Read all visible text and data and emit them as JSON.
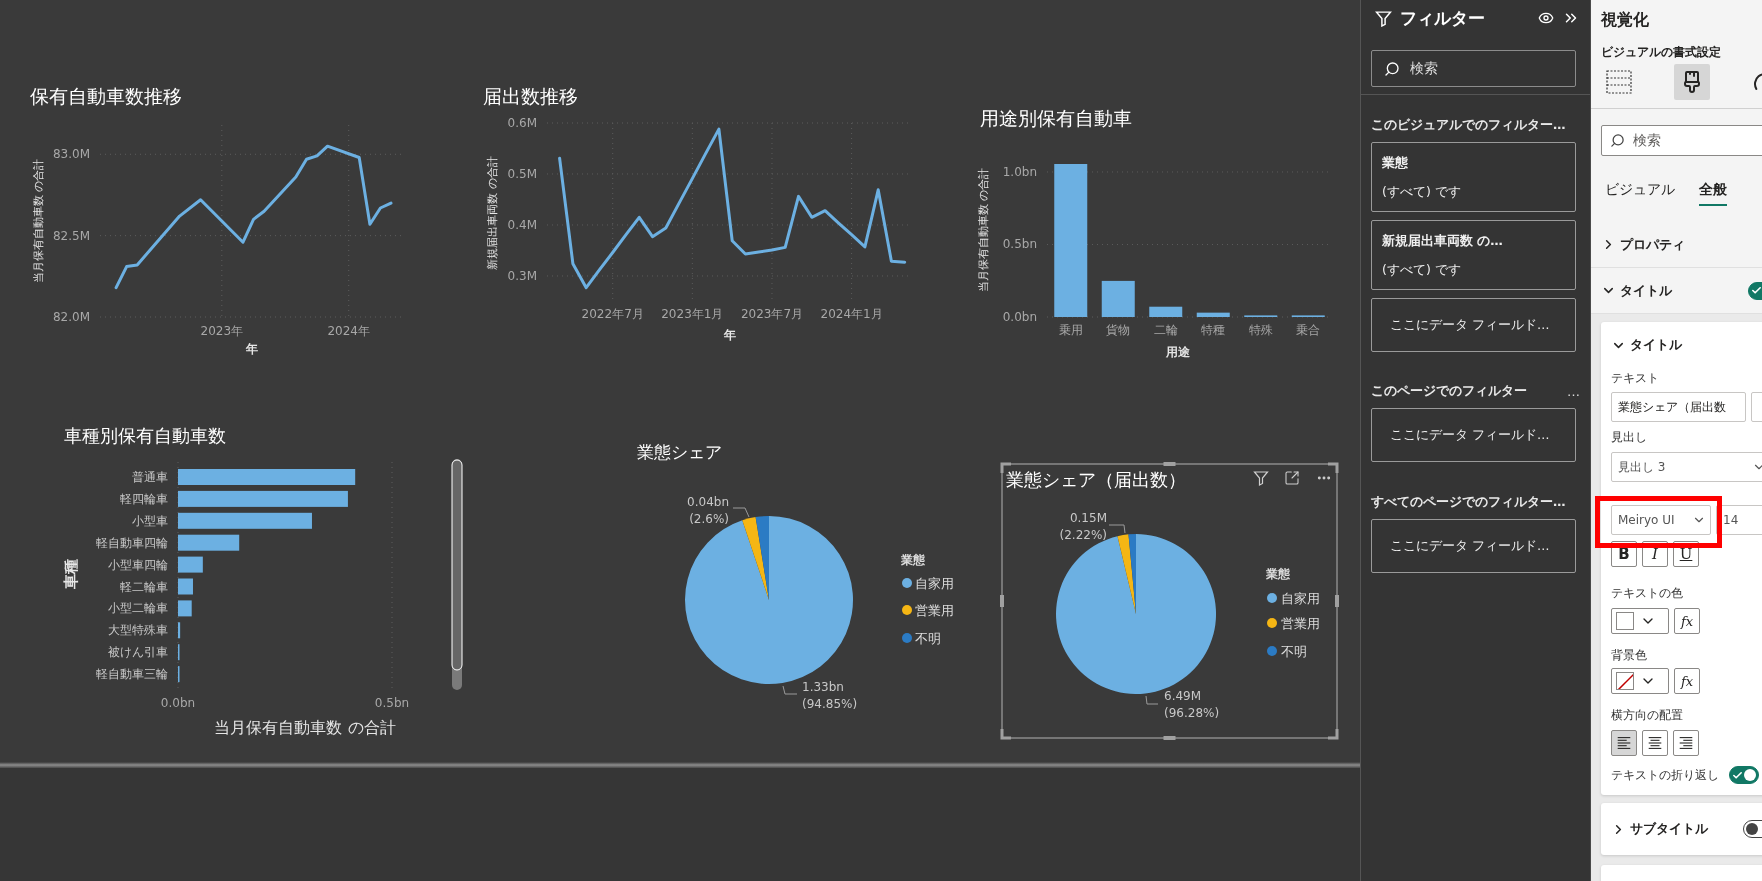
{
  "visuals": [
    {
      "selected": false,
      "title": "保有自動車数推移",
      "chart_data": {
        "type": "line",
        "grid": true,
        "xlabel": "年",
        "ylabel": "当月保有自動車数 の合計",
        "x": [
          2022.167,
          2022.25,
          2022.333,
          2022.667,
          2022.833,
          2023.167,
          2023.25,
          2023.333,
          2023.583,
          2023.667,
          2023.75,
          2023.833,
          2024.083,
          2024.167,
          2024.25,
          2024.333
        ],
        "series": [
          {
            "color": "#6cb0e2",
            "values": [
              82.18,
              82.31,
              82.32,
              82.62,
              82.72,
              82.46,
              82.6,
              82.65,
              82.86,
              82.97,
              82.99,
              83.05,
              82.98,
              82.57,
              82.67,
              82.7
            ]
          }
        ],
        "xlim": [
          2022.04,
          2024.42
        ],
        "ylim": [
          82.0,
          83.18
        ],
        "xticks": [
          {
            "value": 2023,
            "label": "2023年"
          },
          {
            "value": 2024,
            "label": "2024年"
          }
        ],
        "yticks": [
          {
            "value": 82,
            "label": "82.0M"
          },
          {
            "value": 82.5,
            "label": "82.5M"
          },
          {
            "value": 83,
            "label": "83.0M"
          }
        ]
      }
    },
    {
      "selected": false,
      "title": "届出数推移",
      "chart_data": {
        "type": "line",
        "grid": true,
        "xlabel": "年",
        "ylabel": "新規届出車両数 の合計",
        "categories": [
          null,
          null,
          null,
          null,
          "2022年7月",
          null,
          null,
          null,
          null,
          null,
          "2023年1月",
          null,
          null,
          null,
          null,
          null,
          "2023年7月",
          null,
          null,
          null,
          null,
          null,
          "2024年1月",
          null,
          null,
          null,
          null
        ],
        "series": [
          {
            "color": "#6cb0e2",
            "values": [
              0.531,
              0.324,
              0.277,
              0.312,
              0.346,
              0.381,
              0.415,
              0.377,
              0.394,
              0.443,
              0.491,
              0.54,
              0.588,
              0.369,
              0.343,
              0.347,
              0.351,
              0.356,
              0.456,
              0.415,
              0.428,
              0.404,
              0.381,
              0.357,
              0.469,
              0.329,
              0.327
            ]
          }
        ],
        "ylim": [
          0.247,
          0.6
        ],
        "yticks": [
          {
            "value": 0.3,
            "label": "0.3M"
          },
          {
            "value": 0.4,
            "label": "0.4M"
          },
          {
            "value": 0.5,
            "label": "0.5M"
          },
          {
            "value": 0.6,
            "label": "0.6M"
          }
        ]
      }
    },
    {
      "selected": false,
      "title": "用途別保有自動車",
      "chart_data": {
        "type": "bar",
        "orientation": "vertical",
        "xlabel": "用途",
        "ylabel": "当月保有自動車数 の合計",
        "categories": [
          "乗用",
          "貨物",
          "二輪",
          "特種",
          "特殊",
          "乗合"
        ],
        "series": [
          {
            "color": "#6cb0e2",
            "values": [
              1.055,
              0.249,
              0.071,
              0.03,
              0.011,
              0.011
            ]
          }
        ],
        "grid": true,
        "ylim": [
          0,
          1.055
        ],
        "yticks": [
          {
            "value": 0,
            "label": "0.0bn"
          },
          {
            "value": 0.5,
            "label": "0.5bn"
          },
          {
            "value": 1,
            "label": "1.0bn"
          }
        ]
      }
    },
    {
      "selected": false,
      "title": "車種別保有自動車数",
      "chart_data": {
        "type": "bar",
        "orientation": "horizontal",
        "xlabel": "当月保有自動車数 の合計",
        "ylabel": "車種",
        "categories": [
          "普通車",
          "軽四輪車",
          "小型車",
          "軽自動車四輪",
          "小型車四輪",
          "軽二輪車",
          "小型二輪車",
          "大型特殊車",
          "被けん引車",
          "軽自動車三輪"
        ],
        "series": [
          {
            "color": "#6cb0e2",
            "values": [
              0.414,
              0.397,
              0.313,
              0.143,
              0.058,
              0.035,
              0.032,
              0.005,
              0.002,
              0.001
            ]
          }
        ],
        "xlim": [
          0,
          0.5
        ],
        "xticks": [
          {
            "value": 0,
            "label": "0.0bn"
          },
          {
            "value": 0.5,
            "label": "0.5bn"
          }
        ]
      }
    },
    {
      "selected": false,
      "title": "業態シェア",
      "chart_data": {
        "type": "pie",
        "categories": [
          "自家用",
          "営業用",
          "不明"
        ],
        "values": [
          94.85,
          2.6,
          2.55
        ],
        "value_labels": [
          [
            "1.33bn",
            "(94.85%)"
          ],
          [
            "0.04bn",
            "(2.6%)"
          ],
          null
        ],
        "legend": {
          "title": "業態",
          "items": [
            {
              "color": "#6cb0e2"
            },
            {
              "color": "#f5b614"
            },
            {
              "color": "#2b7bc4"
            }
          ]
        }
      }
    },
    {
      "selected": true,
      "title": "業態シェア（届出数）",
      "chart_data": {
        "type": "pie",
        "categories": [
          "自家用",
          "営業用",
          "不明"
        ],
        "values": [
          96.28,
          2.22,
          1.5
        ],
        "value_labels": [
          [
            "6.49M",
            "(96.28%)"
          ],
          [
            "0.15M",
            "(2.22%)"
          ],
          null
        ],
        "legend": {
          "title": "業態",
          "items": [
            {
              "color": "#6cb0e2"
            },
            {
              "color": "#f5b614"
            },
            {
              "color": "#2b7bc4"
            }
          ]
        }
      }
    }
  ],
  "filter_pane": {
    "title": "フィルター",
    "search": {
      "placeholder": "検索"
    },
    "sections": [
      {
        "heading": "このビジュアルでのフィルター…",
        "cards": [
          {
            "kind": "filter",
            "field": "業態",
            "condition": "(すべて) です"
          },
          {
            "kind": "filter",
            "field": "新規届出車両数 の…",
            "condition": "(すべて) です"
          },
          {
            "kind": "drop",
            "label": "ここにデータ フィールド…"
          }
        ]
      },
      {
        "heading": "このページでのフィルター",
        "more": "…",
        "cards": [
          {
            "kind": "drop",
            "label": "ここにデータ フィールド…"
          }
        ]
      },
      {
        "heading": "すべてのページでのフィルター…",
        "cards": [
          {
            "kind": "drop",
            "label": "ここにデータ フィールド…"
          }
        ]
      }
    ]
  },
  "visualizations_pane": {
    "title": "視覚化",
    "subtitle": "ビジュアルの書式設定",
    "modes": [
      {
        "kind": "build",
        "selected": false
      },
      {
        "kind": "format",
        "selected": true
      },
      {
        "kind": "analytics",
        "selected": false
      }
    ],
    "search": {
      "placeholder": "検索"
    },
    "tabs": [
      {
        "label": "ビジュアル",
        "selected": false
      },
      {
        "label": "全般",
        "selected": true
      }
    ],
    "groups": [
      {
        "label": "プロパティ",
        "expanded": false
      },
      {
        "label": "タイトル",
        "expanded": true,
        "on": true
      }
    ],
    "title_card": {
      "label": "タイトル",
      "expanded": true,
      "fields": [
        {
          "kind": "text",
          "label": "テキスト",
          "value": "業態シェア（届出数"
        },
        {
          "kind": "select",
          "label": "見出し",
          "value": "見出し 3"
        },
        {
          "kind": "font",
          "family": "Meiryo UI",
          "size": "14",
          "styles": [
            {
              "label": "B",
              "on": false
            },
            {
              "label": "I",
              "on": false
            },
            {
              "label": "U",
              "on": false
            }
          ]
        },
        {
          "kind": "color",
          "label": "テキストの色",
          "transparent": false,
          "color": "#ffffff",
          "fx": "fx"
        },
        {
          "kind": "color",
          "label": "背景色",
          "transparent": true,
          "fx": "fx"
        },
        {
          "kind": "align",
          "label": "横方向の配置",
          "options": [
            {
              "kind": "left",
              "selected": true
            },
            {
              "kind": "center",
              "selected": false
            },
            {
              "kind": "right",
              "selected": false
            }
          ]
        },
        {
          "kind": "toggle",
          "label": "テキストの折り返し",
          "on": true
        }
      ]
    },
    "subtitle_card": {
      "label": "サブタイトル",
      "expanded": false,
      "on": false
    }
  }
}
